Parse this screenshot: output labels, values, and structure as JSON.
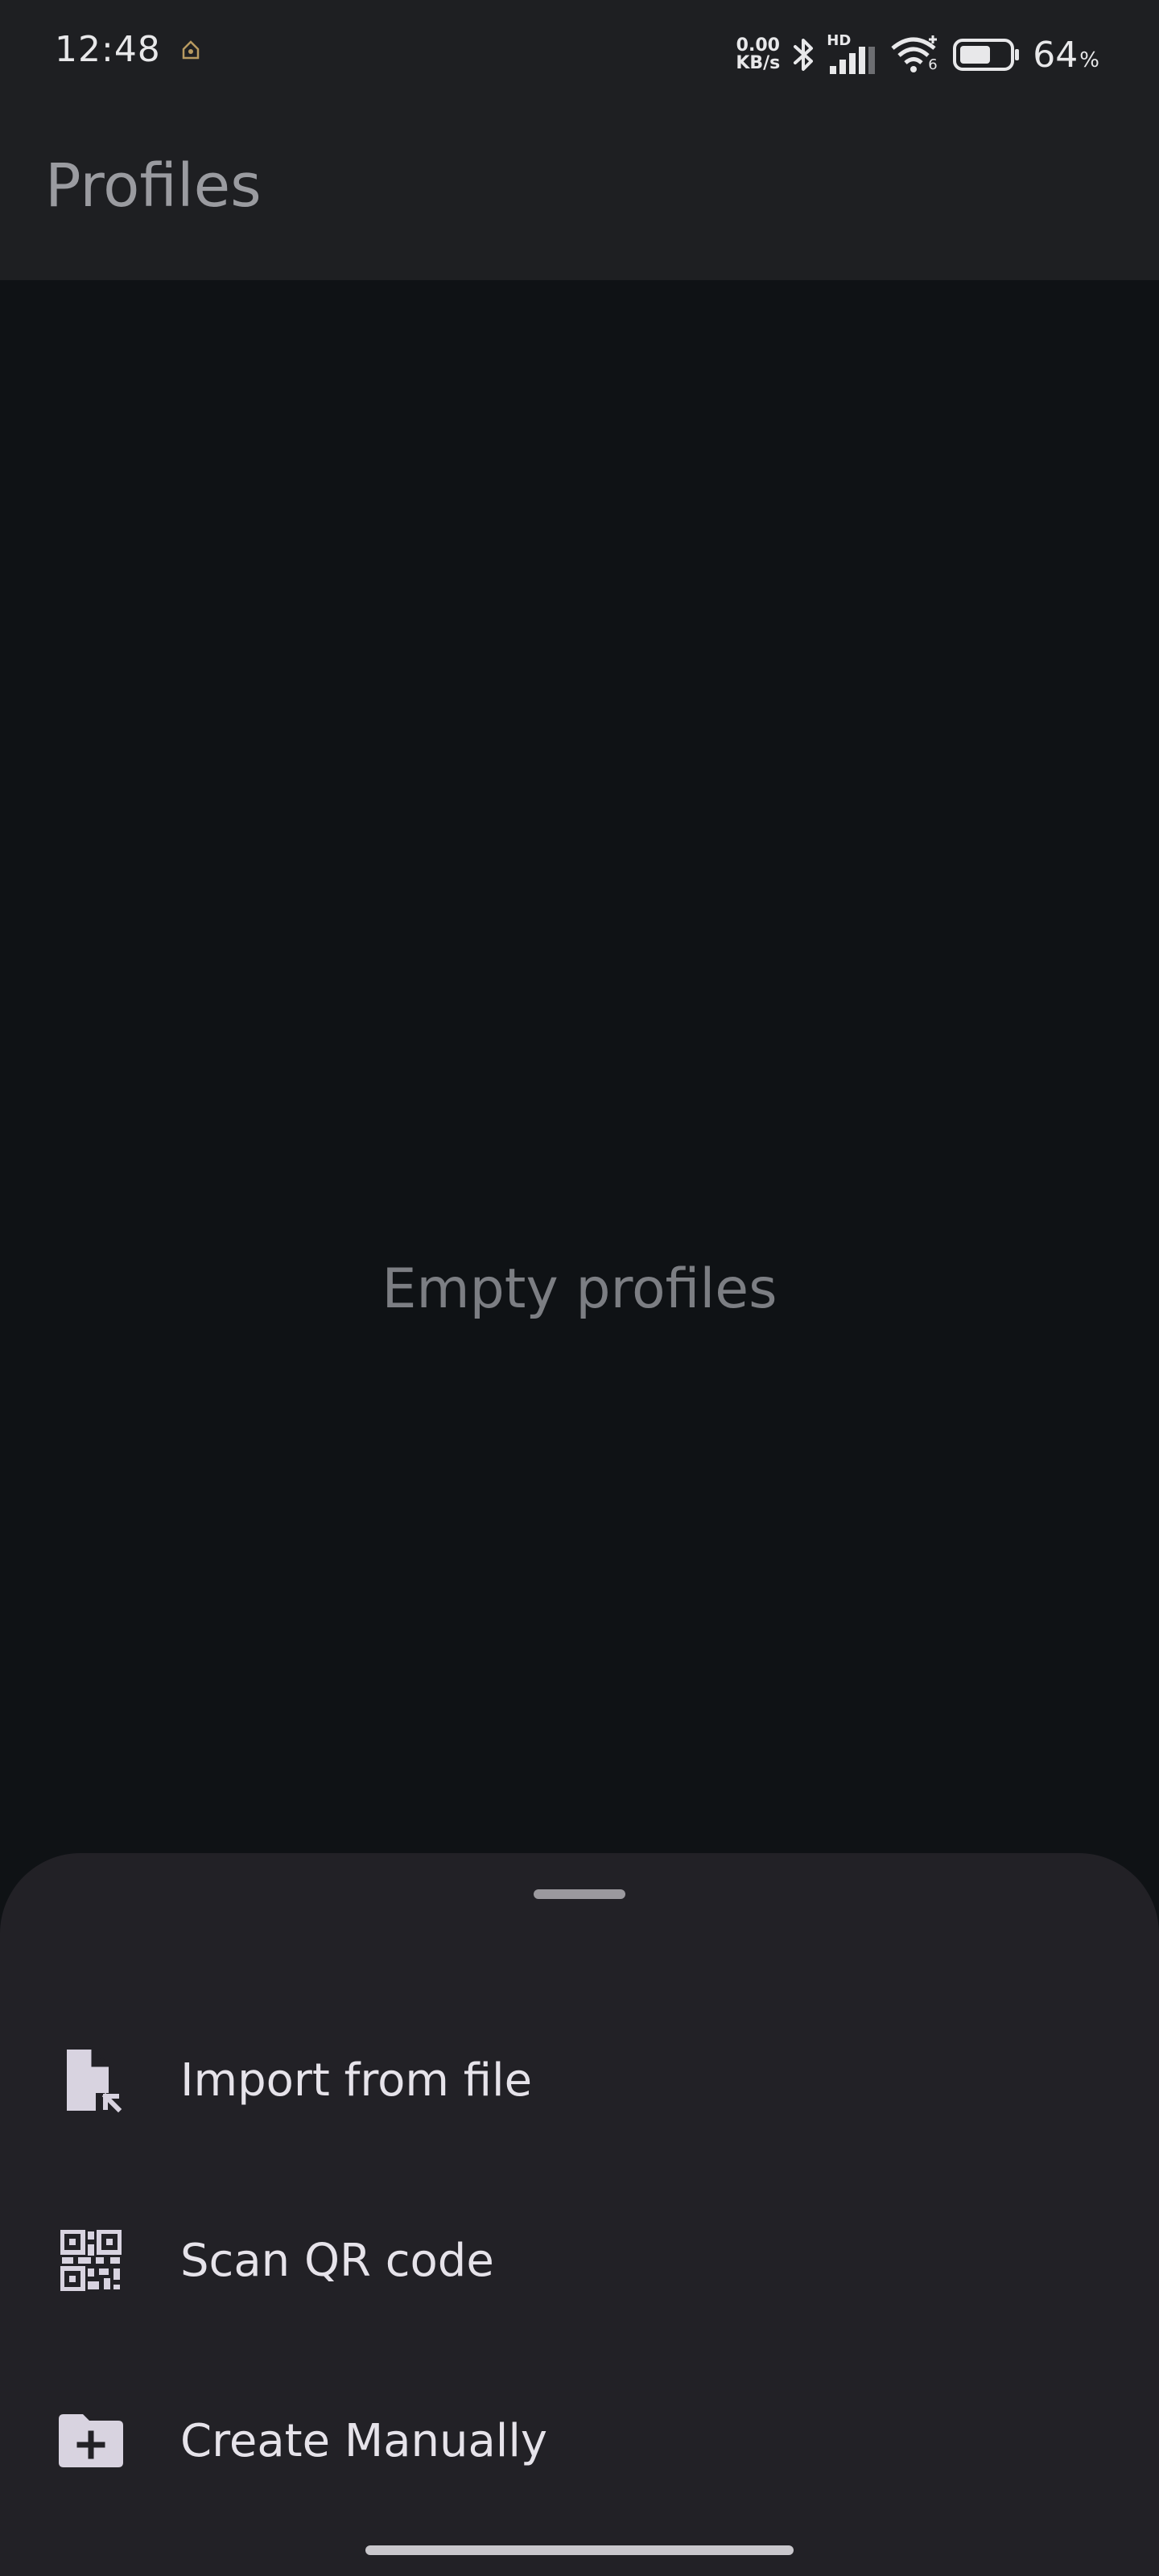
{
  "status_bar": {
    "time": "12:48",
    "net_speed_value": "0.00",
    "net_speed_unit": "KB/s",
    "hd_label": "HD",
    "wifi_label": "6",
    "battery_value": "64",
    "battery_unit": "%",
    "battery_level": 0.64,
    "icons": [
      "notification-icon",
      "bluetooth-icon",
      "cellular-signal-icon",
      "wifi-icon",
      "battery-icon"
    ]
  },
  "app_bar": {
    "title": "Profiles"
  },
  "content": {
    "empty_message": "Empty profiles"
  },
  "bottom_sheet": {
    "items": [
      {
        "label": "Import from file",
        "icon": "file-import-icon"
      },
      {
        "label": "Scan QR code",
        "icon": "qr-code-icon"
      },
      {
        "label": "Create Manually",
        "icon": "folder-add-icon"
      }
    ]
  },
  "colors": {
    "background": "#0f1215",
    "app_bar": "#1e1f22",
    "sheet": "#222126",
    "icon_tint": "#d8d3e0",
    "title_text": "#9a9ba0"
  }
}
